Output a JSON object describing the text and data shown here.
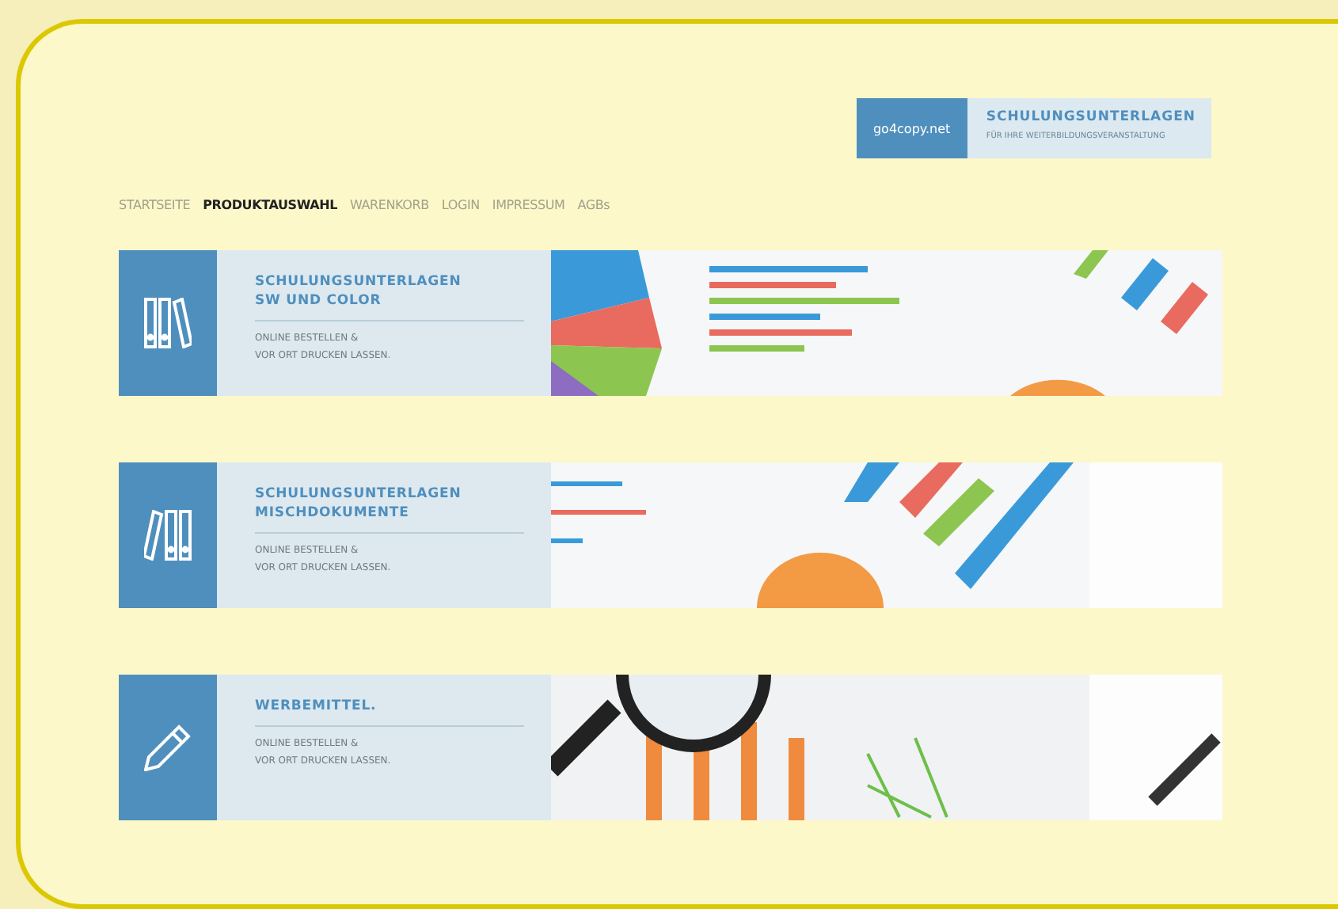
{
  "logo": {
    "brand": "go4copy.net",
    "title": "SCHULUNGSUNTERLAGEN",
    "subtitle": "FÜR IHRE WEITERBILDUNGSVERANSTALTUNG"
  },
  "nav": [
    {
      "label": "STARTSEITE",
      "selected": false
    },
    {
      "label": "PRODUKTAUSWAHL",
      "selected": true
    },
    {
      "label": "WARENKORB",
      "selected": false
    },
    {
      "label": "LOGIN",
      "selected": false
    },
    {
      "label": "IMPRESSUM",
      "selected": false
    },
    {
      "label": "AGBs",
      "selected": false
    }
  ],
  "cards": [
    {
      "kind": "binders-right",
      "title_lines": [
        "SCHULUNGSUNTERLAGEN",
        "SW UND COLOR"
      ],
      "text_lines": [
        "ONLINE BESTELLEN &",
        "VOR ORT DRUCKEN LASSEN."
      ]
    },
    {
      "kind": "binders-left",
      "title_lines": [
        "SCHULUNGSUNTERLAGEN",
        "MISCHDOKUMENTE"
      ],
      "text_lines": [
        "ONLINE BESTELLEN &",
        "VOR ORT DRUCKEN LASSEN."
      ]
    },
    {
      "kind": "pencil",
      "title_lines": [
        "WERBEMITTEL."
      ],
      "text_lines": [
        "ONLINE BESTELLEN &",
        "VOR ORT DRUCKEN LASSEN."
      ]
    }
  ]
}
